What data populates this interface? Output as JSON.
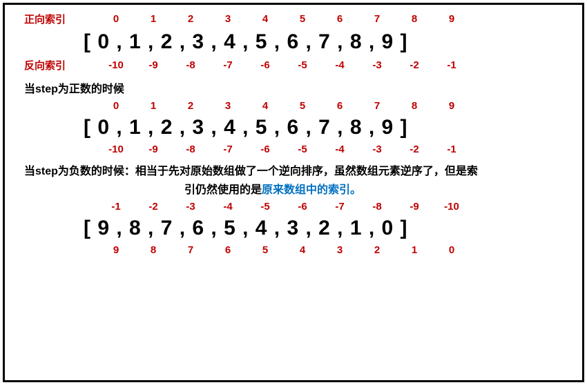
{
  "section1": {
    "forward_label": "正向索引",
    "reverse_label": "反向索引",
    "forward_indices": [
      "0",
      "1",
      "2",
      "3",
      "4",
      "5",
      "6",
      "7",
      "8",
      "9"
    ],
    "reverse_indices": [
      "-10",
      "-9",
      "-8",
      "-7",
      "-6",
      "-5",
      "-4",
      "-3",
      "-2",
      "-1"
    ],
    "array_display": "[ 0 , 1 , 2 , 3 , 4 , 5 , 6 , 7 , 8 , 9 ]"
  },
  "section2": {
    "heading": "当step为正数的时候",
    "forward_indices": [
      "0",
      "1",
      "2",
      "3",
      "4",
      "5",
      "6",
      "7",
      "8",
      "9"
    ],
    "reverse_indices": [
      "-10",
      "-9",
      "-8",
      "-7",
      "-6",
      "-5",
      "-4",
      "-3",
      "-2",
      "-1"
    ],
    "array_display": "[ 0 , 1 , 2 , 3 , 4 , 5 , 6 , 7 , 8 , 9 ]"
  },
  "section3": {
    "heading_part1": "当step为负数的时候：相当于先对原始数组做了一个逆向排序，虽然数组元素逆序了，但是索",
    "heading_part2a": "引仍然使用的是",
    "heading_part2b": "原来数组中的索引。",
    "top_indices": [
      "-1",
      "-2",
      "-3",
      "-4",
      "-5",
      "-6",
      "-7",
      "-8",
      "-9",
      "-10"
    ],
    "bottom_indices": [
      "9",
      "8",
      "7",
      "6",
      "5",
      "4",
      "3",
      "2",
      "1",
      "0"
    ],
    "array_display": "[ 9 , 8 , 7 , 6 , 5 , 4 , 3 , 2 , 1 , 0 ]"
  },
  "chart_data": {
    "type": "table",
    "title": "Python array slicing index diagram",
    "arrays": [
      {
        "name": "original",
        "values": [
          0,
          1,
          2,
          3,
          4,
          5,
          6,
          7,
          8,
          9
        ],
        "forward_index": [
          0,
          1,
          2,
          3,
          4,
          5,
          6,
          7,
          8,
          9
        ],
        "reverse_index": [
          -10,
          -9,
          -8,
          -7,
          -6,
          -5,
          -4,
          -3,
          -2,
          -1
        ]
      },
      {
        "name": "step_positive",
        "values": [
          0,
          1,
          2,
          3,
          4,
          5,
          6,
          7,
          8,
          9
        ],
        "forward_index": [
          0,
          1,
          2,
          3,
          4,
          5,
          6,
          7,
          8,
          9
        ],
        "reverse_index": [
          -10,
          -9,
          -8,
          -7,
          -6,
          -5,
          -4,
          -3,
          -2,
          -1
        ]
      },
      {
        "name": "step_negative_reversed",
        "values": [
          9,
          8,
          7,
          6,
          5,
          4,
          3,
          2,
          1,
          0
        ],
        "top_index": [
          -1,
          -2,
          -3,
          -4,
          -5,
          -6,
          -7,
          -8,
          -9,
          -10
        ],
        "bottom_index": [
          9,
          8,
          7,
          6,
          5,
          4,
          3,
          2,
          1,
          0
        ]
      }
    ]
  }
}
